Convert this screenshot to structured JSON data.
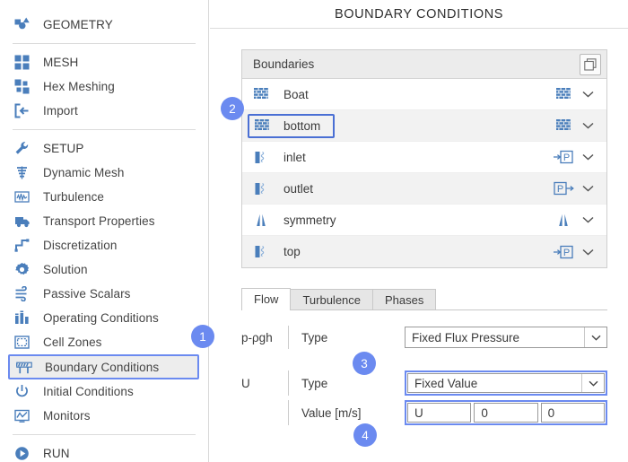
{
  "header": {
    "title": "BOUNDARY CONDITIONS"
  },
  "sidebar": {
    "groups": [
      {
        "items": [
          {
            "label": "GEOMETRY",
            "icon": "geometry-icon"
          }
        ]
      },
      {
        "items": [
          {
            "label": "MESH",
            "icon": "mesh-icon"
          },
          {
            "label": "Hex Meshing",
            "icon": "hex-meshing-icon"
          },
          {
            "label": "Import",
            "icon": "import-icon"
          }
        ]
      },
      {
        "items": [
          {
            "label": "SETUP",
            "icon": "wrench-icon"
          },
          {
            "label": "Dynamic Mesh",
            "icon": "dynamic-mesh-icon"
          },
          {
            "label": "Turbulence",
            "icon": "turbulence-icon"
          },
          {
            "label": "Transport Properties",
            "icon": "truck-icon"
          },
          {
            "label": "Discretization",
            "icon": "discretization-icon"
          },
          {
            "label": "Solution",
            "icon": "gear-icon"
          },
          {
            "label": "Passive Scalars",
            "icon": "wind-icon"
          },
          {
            "label": "Operating Conditions",
            "icon": "bars-icon"
          },
          {
            "label": "Cell Zones",
            "icon": "cell-zones-icon"
          },
          {
            "label": "Boundary Conditions",
            "icon": "barrier-icon",
            "selected": true
          },
          {
            "label": "Initial Conditions",
            "icon": "power-icon"
          },
          {
            "label": "Monitors",
            "icon": "monitor-icon"
          }
        ]
      },
      {
        "items": [
          {
            "label": "RUN",
            "icon": "play-icon"
          }
        ]
      }
    ]
  },
  "boundaries": {
    "panel_title": "Boundaries",
    "copy_button_icon": "copy-icon",
    "rows": [
      {
        "name": "Boat",
        "left_icon": "wall-icon",
        "right_icon": "wall-icon",
        "chevron": "chevron-down-icon",
        "shaded": false,
        "selected": false
      },
      {
        "name": "bottom",
        "left_icon": "wall-icon",
        "right_icon": "wall-icon",
        "chevron": "chevron-down-icon",
        "shaded": true,
        "selected": true
      },
      {
        "name": "inlet",
        "left_icon": "patch-icon",
        "right_icon": "pressure-in-icon",
        "chevron": "chevron-down-icon",
        "shaded": false,
        "selected": false
      },
      {
        "name": "outlet",
        "left_icon": "patch-icon",
        "right_icon": "pressure-out-icon",
        "chevron": "chevron-down-icon",
        "shaded": true,
        "selected": false
      },
      {
        "name": "symmetry",
        "left_icon": "symmetry-icon",
        "right_icon": "symmetry-icon",
        "chevron": "chevron-down-icon",
        "shaded": false,
        "selected": false
      },
      {
        "name": "top",
        "left_icon": "patch-icon",
        "right_icon": "pressure-in-icon",
        "chevron": "chevron-down-icon",
        "shaded": true,
        "selected": false
      }
    ]
  },
  "tabs": [
    {
      "label": "Flow",
      "active": true
    },
    {
      "label": "Turbulence",
      "active": false
    },
    {
      "label": "Phases",
      "active": false
    }
  ],
  "form": {
    "p_rgh": {
      "field_label": "p-ρgh",
      "type_label": "Type",
      "type_value": "Fixed Flux Pressure"
    },
    "U": {
      "field_label": "U",
      "type_label": "Type",
      "type_value": "Fixed Value",
      "value_label": "Value [m/s]",
      "values": [
        "U",
        "0",
        "0"
      ]
    }
  },
  "badges": [
    {
      "number": "1"
    },
    {
      "number": "2"
    },
    {
      "number": "3"
    },
    {
      "number": "4"
    }
  ],
  "colors": {
    "accent_blue": "#6b8af0",
    "icon_blue": "#4a7ebb",
    "select_border": "#4a6fd4",
    "row_shade": "#f2f2f2",
    "header_shade": "#ececec"
  }
}
